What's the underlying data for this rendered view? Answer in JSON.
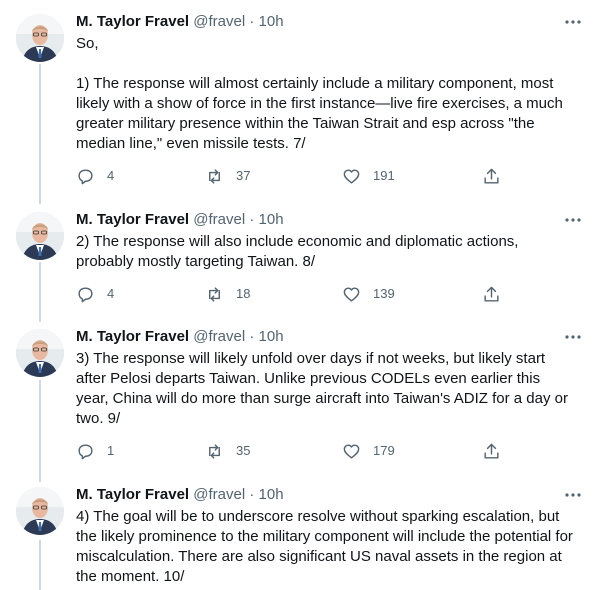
{
  "tweets": [
    {
      "name": "M. Taylor Fravel",
      "handle": "@fravel",
      "dot": "·",
      "time": "10h",
      "text": "So,\n\n1) The response will almost certainly include a military component, most likely with a show of force in the first instance—live fire exercises, a much greater military presence within the Taiwan Strait and esp across \"the median line,\" even missile tests. 7/",
      "replies": "4",
      "retweets": "37",
      "likes": "191"
    },
    {
      "name": "M. Taylor Fravel",
      "handle": "@fravel",
      "dot": "·",
      "time": "10h",
      "text": "2) The response will also include economic and diplomatic actions, probably mostly targeting Taiwan. 8/",
      "replies": "4",
      "retweets": "18",
      "likes": "139"
    },
    {
      "name": "M. Taylor Fravel",
      "handle": "@fravel",
      "dot": "·",
      "time": "10h",
      "text": "3) The response will likely unfold over days if not weeks, but likely start after Pelosi departs Taiwan. Unlike previous CODELs even earlier this year, China will do more than surge aircraft into Taiwan's ADIZ for a day or two. 9/",
      "replies": "1",
      "retweets": "35",
      "likes": "179"
    },
    {
      "name": "M. Taylor Fravel",
      "handle": "@fravel",
      "dot": "·",
      "time": "10h",
      "text": "4) The goal will be to underscore resolve without sparking escalation, but the likely prominence to the military component will include the potential for miscalculation. There are also significant US naval assets in the region at the moment. 10/"
    }
  ],
  "icons": {
    "more": "more-icon",
    "reply": "reply-icon",
    "retweet": "retweet-icon",
    "like": "heart-icon",
    "share": "share-icon"
  },
  "colors": {
    "text": "#0f1419",
    "secondary": "#536471",
    "thread_line": "#cfd9de"
  }
}
